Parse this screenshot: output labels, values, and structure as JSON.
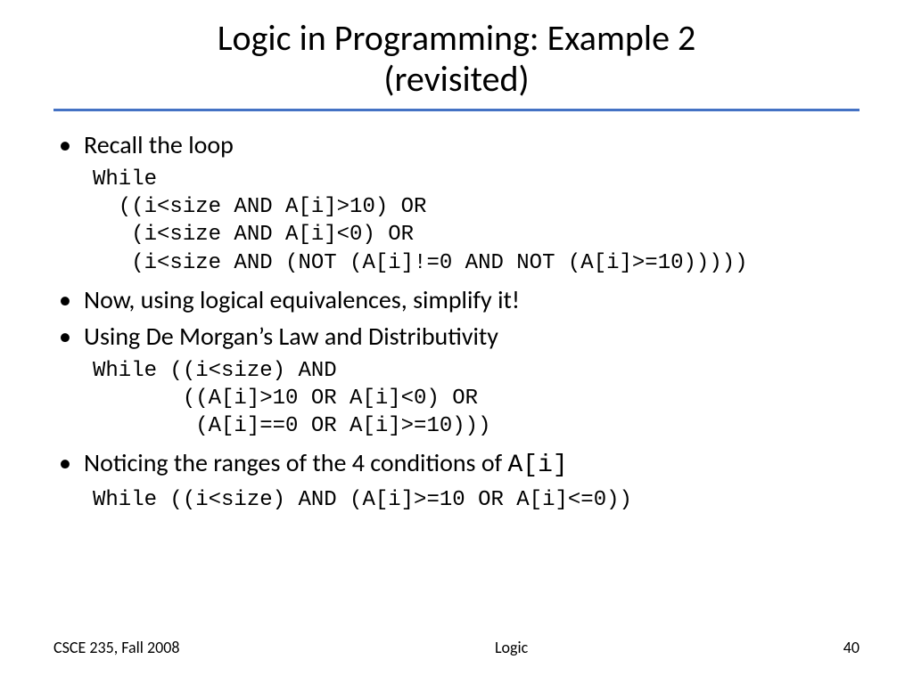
{
  "title_line1": "Logic in Programming: Example 2",
  "title_line2": "(revisited)",
  "bullets": {
    "b1": "Recall the loop",
    "code1": "While\n  ((i<size AND A[i]>10) OR\n   (i<size AND A[i]<0) OR\n   (i<size AND (NOT (A[i]!=0 AND NOT (A[i]>=10)))))",
    "b2": "Now, using logical equivalences, simplify it!",
    "b3": "Using De Morgan’s Law and Distributivity",
    "code2": "While ((i<size) AND\n       ((A[i]>10 OR A[i]<0) OR\n        (A[i]==0 OR A[i]>=10)))",
    "b4_pre": "Noticing the ranges of the 4 conditions of ",
    "b4_code": "A[i]",
    "code3": "While ((i<size) AND (A[i]>=10 OR A[i]<=0))"
  },
  "footer": {
    "left": "CSCE 235, Fall 2008",
    "center": "Logic",
    "right": "40"
  }
}
